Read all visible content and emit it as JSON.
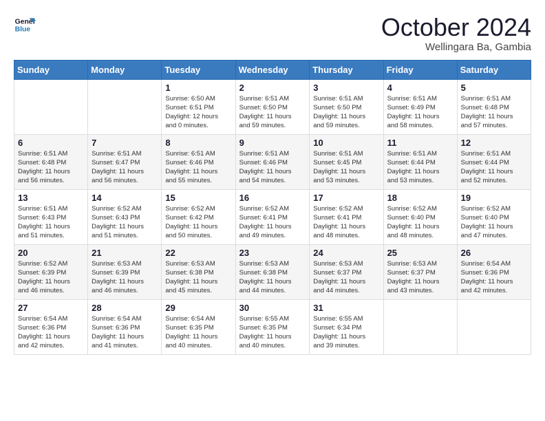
{
  "header": {
    "logo_line1": "General",
    "logo_line2": "Blue",
    "month": "October 2024",
    "location": "Wellingara Ba, Gambia"
  },
  "weekdays": [
    "Sunday",
    "Monday",
    "Tuesday",
    "Wednesday",
    "Thursday",
    "Friday",
    "Saturday"
  ],
  "weeks": [
    [
      {
        "day": "",
        "info": ""
      },
      {
        "day": "",
        "info": ""
      },
      {
        "day": "1",
        "info": "Sunrise: 6:50 AM\nSunset: 6:51 PM\nDaylight: 12 hours\nand 0 minutes."
      },
      {
        "day": "2",
        "info": "Sunrise: 6:51 AM\nSunset: 6:50 PM\nDaylight: 11 hours\nand 59 minutes."
      },
      {
        "day": "3",
        "info": "Sunrise: 6:51 AM\nSunset: 6:50 PM\nDaylight: 11 hours\nand 59 minutes."
      },
      {
        "day": "4",
        "info": "Sunrise: 6:51 AM\nSunset: 6:49 PM\nDaylight: 11 hours\nand 58 minutes."
      },
      {
        "day": "5",
        "info": "Sunrise: 6:51 AM\nSunset: 6:48 PM\nDaylight: 11 hours\nand 57 minutes."
      }
    ],
    [
      {
        "day": "6",
        "info": "Sunrise: 6:51 AM\nSunset: 6:48 PM\nDaylight: 11 hours\nand 56 minutes."
      },
      {
        "day": "7",
        "info": "Sunrise: 6:51 AM\nSunset: 6:47 PM\nDaylight: 11 hours\nand 56 minutes."
      },
      {
        "day": "8",
        "info": "Sunrise: 6:51 AM\nSunset: 6:46 PM\nDaylight: 11 hours\nand 55 minutes."
      },
      {
        "day": "9",
        "info": "Sunrise: 6:51 AM\nSunset: 6:46 PM\nDaylight: 11 hours\nand 54 minutes."
      },
      {
        "day": "10",
        "info": "Sunrise: 6:51 AM\nSunset: 6:45 PM\nDaylight: 11 hours\nand 53 minutes."
      },
      {
        "day": "11",
        "info": "Sunrise: 6:51 AM\nSunset: 6:44 PM\nDaylight: 11 hours\nand 53 minutes."
      },
      {
        "day": "12",
        "info": "Sunrise: 6:51 AM\nSunset: 6:44 PM\nDaylight: 11 hours\nand 52 minutes."
      }
    ],
    [
      {
        "day": "13",
        "info": "Sunrise: 6:51 AM\nSunset: 6:43 PM\nDaylight: 11 hours\nand 51 minutes."
      },
      {
        "day": "14",
        "info": "Sunrise: 6:52 AM\nSunset: 6:43 PM\nDaylight: 11 hours\nand 51 minutes."
      },
      {
        "day": "15",
        "info": "Sunrise: 6:52 AM\nSunset: 6:42 PM\nDaylight: 11 hours\nand 50 minutes."
      },
      {
        "day": "16",
        "info": "Sunrise: 6:52 AM\nSunset: 6:41 PM\nDaylight: 11 hours\nand 49 minutes."
      },
      {
        "day": "17",
        "info": "Sunrise: 6:52 AM\nSunset: 6:41 PM\nDaylight: 11 hours\nand 48 minutes."
      },
      {
        "day": "18",
        "info": "Sunrise: 6:52 AM\nSunset: 6:40 PM\nDaylight: 11 hours\nand 48 minutes."
      },
      {
        "day": "19",
        "info": "Sunrise: 6:52 AM\nSunset: 6:40 PM\nDaylight: 11 hours\nand 47 minutes."
      }
    ],
    [
      {
        "day": "20",
        "info": "Sunrise: 6:52 AM\nSunset: 6:39 PM\nDaylight: 11 hours\nand 46 minutes."
      },
      {
        "day": "21",
        "info": "Sunrise: 6:53 AM\nSunset: 6:39 PM\nDaylight: 11 hours\nand 46 minutes."
      },
      {
        "day": "22",
        "info": "Sunrise: 6:53 AM\nSunset: 6:38 PM\nDaylight: 11 hours\nand 45 minutes."
      },
      {
        "day": "23",
        "info": "Sunrise: 6:53 AM\nSunset: 6:38 PM\nDaylight: 11 hours\nand 44 minutes."
      },
      {
        "day": "24",
        "info": "Sunrise: 6:53 AM\nSunset: 6:37 PM\nDaylight: 11 hours\nand 44 minutes."
      },
      {
        "day": "25",
        "info": "Sunrise: 6:53 AM\nSunset: 6:37 PM\nDaylight: 11 hours\nand 43 minutes."
      },
      {
        "day": "26",
        "info": "Sunrise: 6:54 AM\nSunset: 6:36 PM\nDaylight: 11 hours\nand 42 minutes."
      }
    ],
    [
      {
        "day": "27",
        "info": "Sunrise: 6:54 AM\nSunset: 6:36 PM\nDaylight: 11 hours\nand 42 minutes."
      },
      {
        "day": "28",
        "info": "Sunrise: 6:54 AM\nSunset: 6:36 PM\nDaylight: 11 hours\nand 41 minutes."
      },
      {
        "day": "29",
        "info": "Sunrise: 6:54 AM\nSunset: 6:35 PM\nDaylight: 11 hours\nand 40 minutes."
      },
      {
        "day": "30",
        "info": "Sunrise: 6:55 AM\nSunset: 6:35 PM\nDaylight: 11 hours\nand 40 minutes."
      },
      {
        "day": "31",
        "info": "Sunrise: 6:55 AM\nSunset: 6:34 PM\nDaylight: 11 hours\nand 39 minutes."
      },
      {
        "day": "",
        "info": ""
      },
      {
        "day": "",
        "info": ""
      }
    ]
  ]
}
